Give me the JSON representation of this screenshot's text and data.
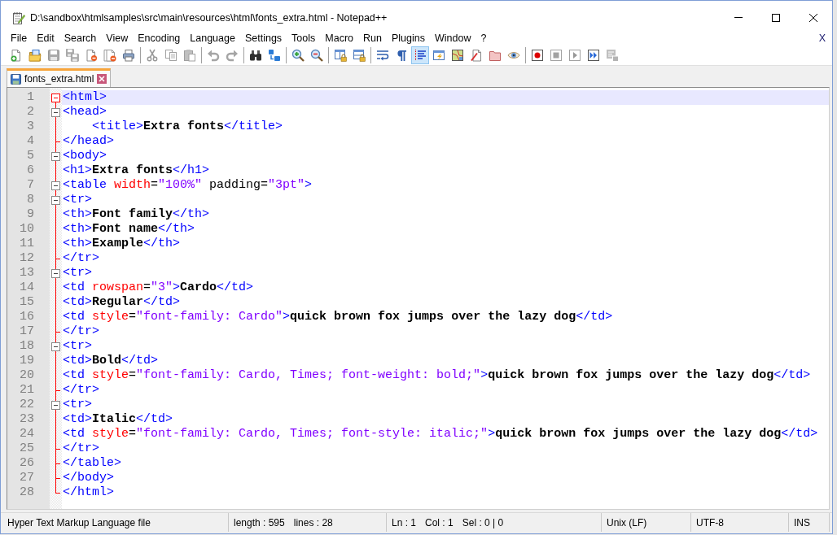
{
  "window": {
    "title": "D:\\sandbox\\htmlsamples\\src\\main\\resources\\html\\fonts_extra.html - Notepad++"
  },
  "menu": {
    "items": [
      "File",
      "Edit",
      "Search",
      "View",
      "Encoding",
      "Language",
      "Settings",
      "Tools",
      "Macro",
      "Run",
      "Plugins",
      "Window",
      "?"
    ],
    "close_label": "X"
  },
  "toolbar": {
    "groups": [
      [
        {
          "kind": "new",
          "disabled": false,
          "pressed": false
        },
        {
          "kind": "open",
          "disabled": false,
          "pressed": false
        },
        {
          "kind": "save",
          "disabled": true,
          "pressed": false
        },
        {
          "kind": "saveall",
          "disabled": true,
          "pressed": false
        },
        {
          "kind": "close",
          "disabled": false,
          "pressed": false
        },
        {
          "kind": "closeall",
          "disabled": false,
          "pressed": false
        },
        {
          "kind": "print",
          "disabled": false,
          "pressed": false
        }
      ],
      [
        {
          "kind": "cut",
          "disabled": true,
          "pressed": false
        },
        {
          "kind": "copy",
          "disabled": true,
          "pressed": false
        },
        {
          "kind": "paste",
          "disabled": true,
          "pressed": false
        }
      ],
      [
        {
          "kind": "undo",
          "disabled": true,
          "pressed": false
        },
        {
          "kind": "redo",
          "disabled": true,
          "pressed": false
        }
      ],
      [
        {
          "kind": "find",
          "disabled": false,
          "pressed": false
        },
        {
          "kind": "replace",
          "disabled": false,
          "pressed": false
        }
      ],
      [
        {
          "kind": "zoomin",
          "disabled": false,
          "pressed": false
        },
        {
          "kind": "zoomout",
          "disabled": false,
          "pressed": false
        }
      ],
      [
        {
          "kind": "syncv",
          "disabled": false,
          "pressed": false
        },
        {
          "kind": "synch",
          "disabled": false,
          "pressed": false
        }
      ],
      [
        {
          "kind": "wrap",
          "disabled": false,
          "pressed": false
        },
        {
          "kind": "allchars",
          "disabled": false,
          "pressed": false
        },
        {
          "kind": "indentguide",
          "disabled": false,
          "pressed": true
        },
        {
          "kind": "udl",
          "disabled": false,
          "pressed": false
        },
        {
          "kind": "docmap",
          "disabled": false,
          "pressed": false
        },
        {
          "kind": "funclist",
          "disabled": false,
          "pressed": false
        },
        {
          "kind": "workspace",
          "disabled": false,
          "pressed": false
        },
        {
          "kind": "monitor",
          "disabled": false,
          "pressed": false
        }
      ],
      [
        {
          "kind": "record",
          "disabled": false,
          "pressed": false
        },
        {
          "kind": "stop",
          "disabled": true,
          "pressed": false
        },
        {
          "kind": "play",
          "disabled": true,
          "pressed": false
        },
        {
          "kind": "playmulti",
          "disabled": false,
          "pressed": false
        },
        {
          "kind": "savemacro",
          "disabled": true,
          "pressed": false
        }
      ]
    ]
  },
  "tabs": [
    {
      "label": "fonts_extra.html",
      "selected": true,
      "modified": false
    }
  ],
  "editor": {
    "lines": [
      {
        "number": "1",
        "fold": {
          "kind": "head"
        },
        "current": true,
        "tokens": [
          {
            "kind": "tag",
            "text": "<html>"
          }
        ]
      },
      {
        "number": "2",
        "fold": {
          "kind": "open"
        },
        "current": false,
        "tokens": [
          {
            "kind": "tag",
            "text": "<head>"
          }
        ]
      },
      {
        "number": "3",
        "fold": {
          "kind": "line"
        },
        "current": false,
        "tokens": [
          {
            "kind": "tag",
            "text": "    <title>"
          },
          {
            "kind": "text",
            "text": "Extra fonts"
          },
          {
            "kind": "tag",
            "text": "</title>"
          }
        ]
      },
      {
        "number": "4",
        "fold": {
          "kind": "tick"
        },
        "current": false,
        "tokens": [
          {
            "kind": "tag",
            "text": "</head>"
          }
        ]
      },
      {
        "number": "5",
        "fold": {
          "kind": "open"
        },
        "current": false,
        "tokens": [
          {
            "kind": "tag",
            "text": "<body>"
          }
        ]
      },
      {
        "number": "6",
        "fold": {
          "kind": "line"
        },
        "current": false,
        "tokens": [
          {
            "kind": "tag",
            "text": "<h1>"
          },
          {
            "kind": "text",
            "text": "Extra fonts"
          },
          {
            "kind": "tag",
            "text": "</h1>"
          }
        ]
      },
      {
        "number": "7",
        "fold": {
          "kind": "open"
        },
        "current": false,
        "tokens": [
          {
            "kind": "tag",
            "text": "<table "
          },
          {
            "kind": "attr",
            "text": "width"
          },
          {
            "kind": "plain",
            "text": "="
          },
          {
            "kind": "value",
            "text": "\"100%\""
          },
          {
            "kind": "plain",
            "text": " padding="
          },
          {
            "kind": "value",
            "text": "\"3pt\""
          },
          {
            "kind": "tag",
            "text": ">"
          }
        ]
      },
      {
        "number": "8",
        "fold": {
          "kind": "open"
        },
        "current": false,
        "tokens": [
          {
            "kind": "tag",
            "text": "<tr>"
          }
        ]
      },
      {
        "number": "9",
        "fold": {
          "kind": "line"
        },
        "current": false,
        "tokens": [
          {
            "kind": "tag",
            "text": "<th>"
          },
          {
            "kind": "text",
            "text": "Font family"
          },
          {
            "kind": "tag",
            "text": "</th>"
          }
        ]
      },
      {
        "number": "10",
        "fold": {
          "kind": "line"
        },
        "current": false,
        "tokens": [
          {
            "kind": "tag",
            "text": "<th>"
          },
          {
            "kind": "text",
            "text": "Font name"
          },
          {
            "kind": "tag",
            "text": "</th>"
          }
        ]
      },
      {
        "number": "11",
        "fold": {
          "kind": "line"
        },
        "current": false,
        "tokens": [
          {
            "kind": "tag",
            "text": "<th>"
          },
          {
            "kind": "text",
            "text": "Example"
          },
          {
            "kind": "tag",
            "text": "</th>"
          }
        ]
      },
      {
        "number": "12",
        "fold": {
          "kind": "tick"
        },
        "current": false,
        "tokens": [
          {
            "kind": "tag",
            "text": "</tr>"
          }
        ]
      },
      {
        "number": "13",
        "fold": {
          "kind": "open"
        },
        "current": false,
        "tokens": [
          {
            "kind": "tag",
            "text": "<tr>"
          }
        ]
      },
      {
        "number": "14",
        "fold": {
          "kind": "line"
        },
        "current": false,
        "tokens": [
          {
            "kind": "tag",
            "text": "<td "
          },
          {
            "kind": "attr",
            "text": "rowspan"
          },
          {
            "kind": "plain",
            "text": "="
          },
          {
            "kind": "value",
            "text": "\"3\""
          },
          {
            "kind": "tag",
            "text": ">"
          },
          {
            "kind": "text",
            "text": "Cardo"
          },
          {
            "kind": "tag",
            "text": "</td>"
          }
        ]
      },
      {
        "number": "15",
        "fold": {
          "kind": "line"
        },
        "current": false,
        "tokens": [
          {
            "kind": "tag",
            "text": "<td>"
          },
          {
            "kind": "text",
            "text": "Regular"
          },
          {
            "kind": "tag",
            "text": "</td>"
          }
        ]
      },
      {
        "number": "16",
        "fold": {
          "kind": "line"
        },
        "current": false,
        "tokens": [
          {
            "kind": "tag",
            "text": "<td "
          },
          {
            "kind": "attr",
            "text": "style"
          },
          {
            "kind": "plain",
            "text": "="
          },
          {
            "kind": "value",
            "text": "\"font-family: Cardo\""
          },
          {
            "kind": "tag",
            "text": ">"
          },
          {
            "kind": "text",
            "text": "quick brown fox jumps over the lazy dog"
          },
          {
            "kind": "tag",
            "text": "</td>"
          }
        ]
      },
      {
        "number": "17",
        "fold": {
          "kind": "tick"
        },
        "current": false,
        "tokens": [
          {
            "kind": "tag",
            "text": "</tr>"
          }
        ]
      },
      {
        "number": "18",
        "fold": {
          "kind": "open"
        },
        "current": false,
        "tokens": [
          {
            "kind": "tag",
            "text": "<tr>"
          }
        ]
      },
      {
        "number": "19",
        "fold": {
          "kind": "line"
        },
        "current": false,
        "tokens": [
          {
            "kind": "tag",
            "text": "<td>"
          },
          {
            "kind": "text",
            "text": "Bold"
          },
          {
            "kind": "tag",
            "text": "</td>"
          }
        ]
      },
      {
        "number": "20",
        "fold": {
          "kind": "line"
        },
        "current": false,
        "tokens": [
          {
            "kind": "tag",
            "text": "<td "
          },
          {
            "kind": "attr",
            "text": "style"
          },
          {
            "kind": "plain",
            "text": "="
          },
          {
            "kind": "value",
            "text": "\"font-family: Cardo, Times; font-weight: bold;\""
          },
          {
            "kind": "tag",
            "text": ">"
          },
          {
            "kind": "text",
            "text": "quick brown fox jumps over the lazy dog"
          },
          {
            "kind": "tag",
            "text": "</td>"
          }
        ]
      },
      {
        "number": "21",
        "fold": {
          "kind": "tick"
        },
        "current": false,
        "tokens": [
          {
            "kind": "tag",
            "text": "</tr>"
          }
        ]
      },
      {
        "number": "22",
        "fold": {
          "kind": "open"
        },
        "current": false,
        "tokens": [
          {
            "kind": "tag",
            "text": "<tr>"
          }
        ]
      },
      {
        "number": "23",
        "fold": {
          "kind": "line"
        },
        "current": false,
        "tokens": [
          {
            "kind": "tag",
            "text": "<td>"
          },
          {
            "kind": "text",
            "text": "Italic"
          },
          {
            "kind": "tag",
            "text": "</td>"
          }
        ]
      },
      {
        "number": "24",
        "fold": {
          "kind": "line"
        },
        "current": false,
        "tokens": [
          {
            "kind": "tag",
            "text": "<td "
          },
          {
            "kind": "attr",
            "text": "style"
          },
          {
            "kind": "plain",
            "text": "="
          },
          {
            "kind": "value",
            "text": "\"font-family: Cardo, Times; font-style: italic;\""
          },
          {
            "kind": "tag",
            "text": ">"
          },
          {
            "kind": "text",
            "text": "quick brown fox jumps over the lazy dog"
          },
          {
            "kind": "tag",
            "text": "</td>"
          }
        ]
      },
      {
        "number": "25",
        "fold": {
          "kind": "tick"
        },
        "current": false,
        "tokens": [
          {
            "kind": "tag",
            "text": "</tr>"
          }
        ]
      },
      {
        "number": "26",
        "fold": {
          "kind": "tick"
        },
        "current": false,
        "tokens": [
          {
            "kind": "tag",
            "text": "</table>"
          }
        ]
      },
      {
        "number": "27",
        "fold": {
          "kind": "tick"
        },
        "current": false,
        "tokens": [
          {
            "kind": "tag",
            "text": "</body>"
          }
        ]
      },
      {
        "number": "28",
        "fold": {
          "kind": "end"
        },
        "current": false,
        "tokens": [
          {
            "kind": "tag",
            "text": "</html>"
          }
        ]
      }
    ]
  },
  "status_bar": {
    "cells": [
      {
        "parts": [
          "Hyper Text Markup Language file"
        ]
      },
      {
        "parts": [
          "length : 595",
          "lines : 28"
        ]
      },
      {
        "parts": [
          "Ln : 1",
          "Col : 1",
          "Sel : 0 | 0"
        ]
      },
      {
        "parts": [
          "Unix (LF)"
        ]
      },
      {
        "parts": [
          "UTF-8"
        ]
      },
      {
        "parts": [
          "INS"
        ]
      }
    ]
  }
}
